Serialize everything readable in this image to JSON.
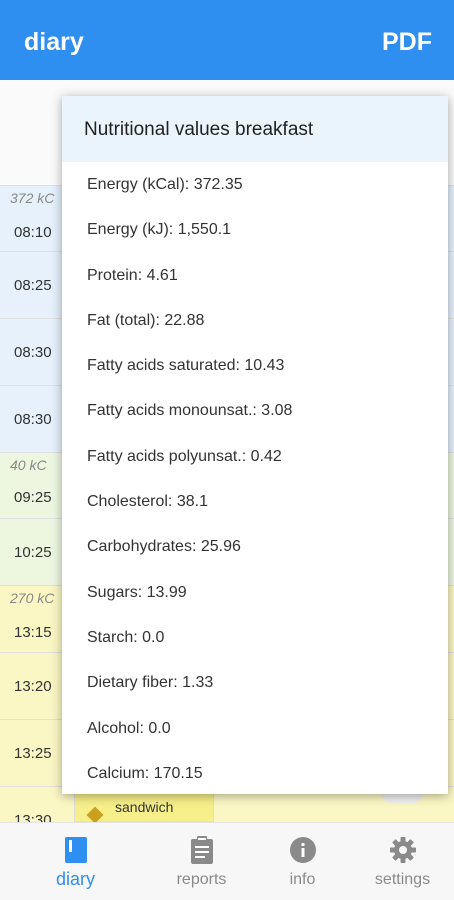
{
  "appbar": {
    "title": "diary",
    "pdf_label": "PDF"
  },
  "diary": {
    "rows": [
      {
        "kcal": "372 kC",
        "time": "08:10"
      },
      {
        "time": "08:25"
      },
      {
        "time": "08:30"
      },
      {
        "time": "08:30"
      },
      {
        "kcal": "40 kC",
        "time": "09:25"
      },
      {
        "time": "10:25"
      },
      {
        "kcal": "270 kC",
        "time": "13:15"
      },
      {
        "time": "13:20"
      },
      {
        "time": "13:25"
      },
      {
        "time": "13:30"
      }
    ],
    "visible_entry": "sandwich"
  },
  "popup": {
    "title": "Nutritional values breakfast",
    "items": [
      "Energy (kCal): 372.35",
      "Energy (kJ): 1,550.1",
      "Protein: 4.61",
      "Fat (total): 22.88",
      "Fatty acids saturated: 10.43",
      "Fatty acids monounsat.: 3.08",
      "Fatty acids polyunsat.: 0.42",
      "Cholesterol: 38.1",
      "Carbohydrates: 25.96",
      "Sugars: 13.99",
      "Starch: 0.0",
      "Dietary fiber: 1.33",
      "Alcohol: 0.0",
      "Calcium: 170.15"
    ]
  },
  "bottomnav": {
    "tabs": [
      {
        "label": "diary",
        "icon": "book-icon",
        "active": true
      },
      {
        "label": "reports",
        "icon": "clipboard-icon",
        "active": false
      },
      {
        "label": "info",
        "icon": "info-icon",
        "active": false
      },
      {
        "label": "settings",
        "icon": "gear-icon",
        "active": false
      }
    ]
  },
  "colors": {
    "primary": "#2f8ff0",
    "breakfast": "#e6f1fc",
    "snack": "#edf7e0",
    "lunch": "#fbf7c4"
  }
}
